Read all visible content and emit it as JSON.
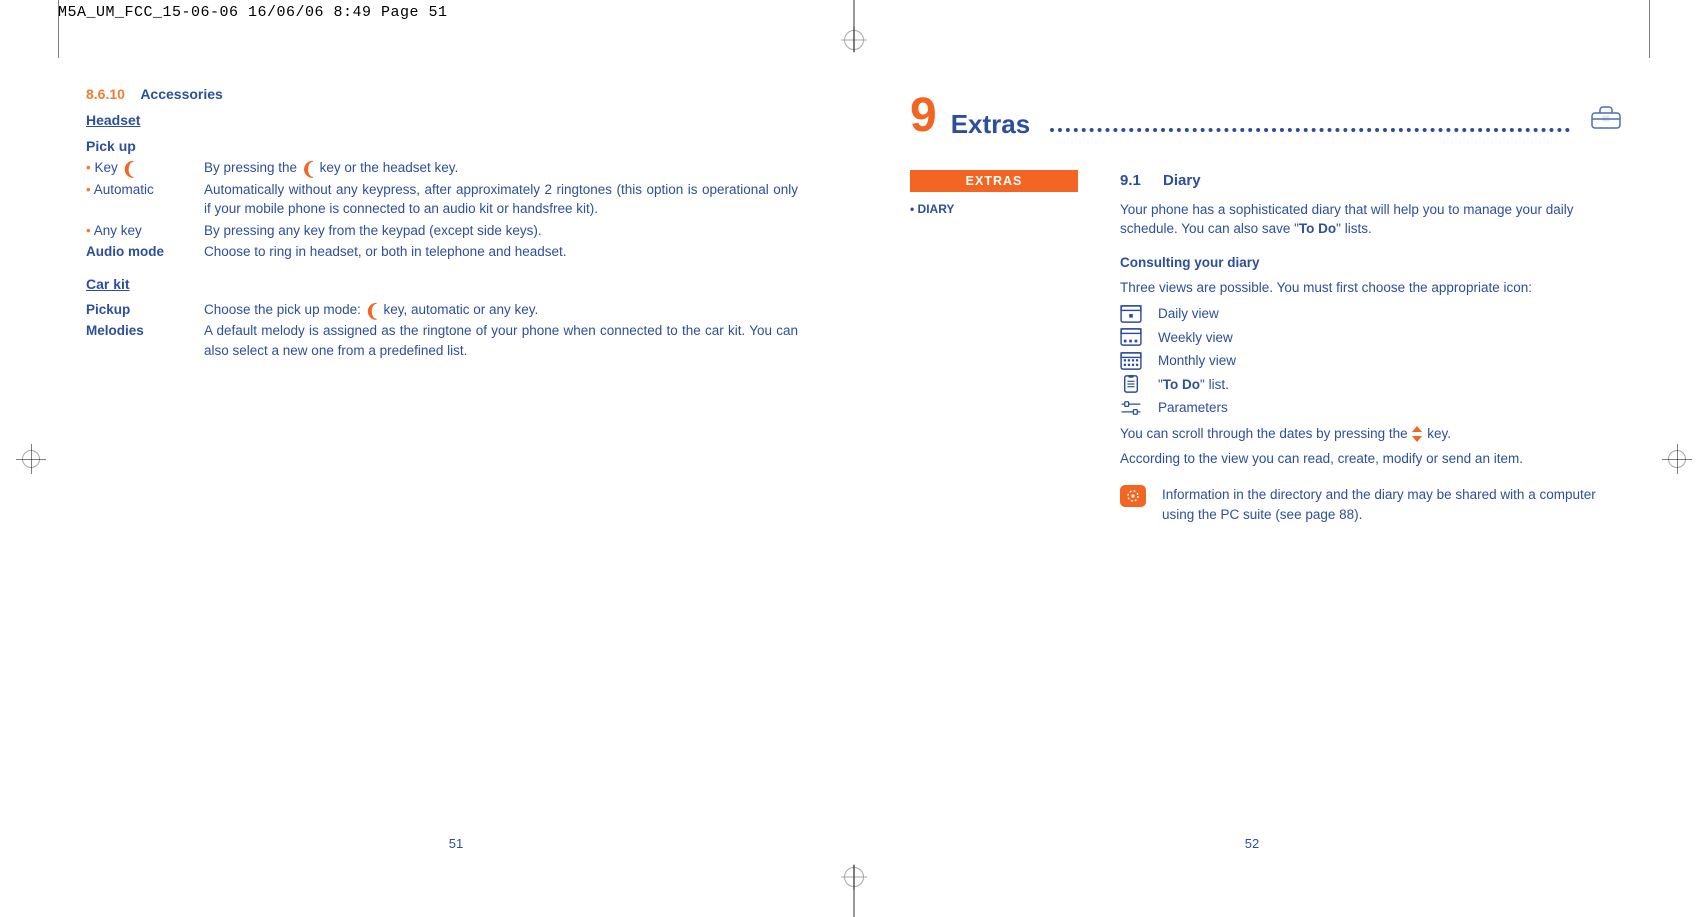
{
  "meta": {
    "header_stamp": "M5A_UM_FCC_15-06-06  16/06/06  8:49  Page 51"
  },
  "left": {
    "section_number": "8.6.10",
    "section_title": "Accessories",
    "headset_heading": "Headset",
    "pickup_heading": "Pick up",
    "rows": {
      "key_label": "Key ",
      "key_desc_a": "By pressing the ",
      "key_desc_b": " key or the headset key.",
      "auto_label": "Automatic",
      "auto_desc": "Automatically without any keypress, after approximately 2 ringtones (this option is operational only if your mobile phone is connected to an audio kit or handsfree kit).",
      "anykey_label": "Any key",
      "anykey_desc": "By pressing any key from the keypad (except side keys).",
      "audio_label": "Audio mode",
      "audio_desc": "Choose to ring in headset, or both in telephone and headset."
    },
    "carkit_heading": "Car kit",
    "carkit": {
      "pickup_label": "Pickup",
      "pickup_desc_a": "Choose the pick up mode: ",
      "pickup_desc_b": " key, automatic or any key.",
      "melodies_label": "Melodies",
      "melodies_desc": "A default melody is assigned as the ringtone of your phone when connected to the car kit. You can also select a new one from a predefined list."
    },
    "page_number": "51"
  },
  "right": {
    "chapter_number": "9",
    "chapter_title": "Extras",
    "sidebar": {
      "pill": "EXTRAS",
      "item1": "DIARY"
    },
    "content": {
      "h_num": "9.1",
      "h_txt": "Diary",
      "intro_a": "Your phone has a sophisticated diary that will help you to manage your daily schedule. You can also save \"",
      "intro_bold": "To Do",
      "intro_b": "\" lists.",
      "consult_heading": "Consulting your diary",
      "three_views": "Three views are possible. You must first choose the appropriate icon:",
      "daily": "Daily view",
      "weekly": "Weekly view",
      "monthly": "Monthly view",
      "todo_a": "\"",
      "todo_bold": "To Do",
      "todo_b": "\" list.",
      "params": "Parameters",
      "scroll_a": "You can scroll through the dates by pressing the ",
      "scroll_b": " key.",
      "according": "According to the view you can read, create, modify or send an item.",
      "note": "Information in the directory and the diary may be shared with a computer using the PC suite (see page 88)."
    },
    "page_number": "52"
  }
}
